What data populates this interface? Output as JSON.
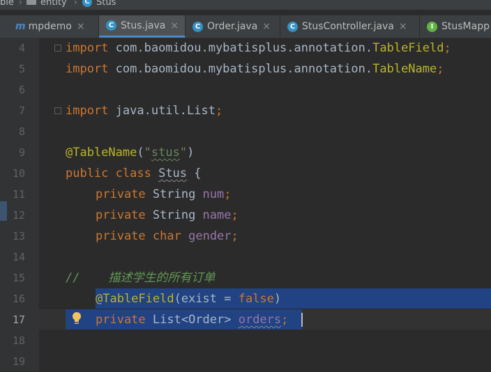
{
  "breadcrumb": {
    "items": [
      "ble",
      "entity",
      "Stus"
    ]
  },
  "tabs": [
    {
      "label": "mpdemo",
      "icon": "module-icon",
      "active": false
    },
    {
      "label": "Stus.java",
      "icon": "class-icon",
      "active": true
    },
    {
      "label": "Order.java",
      "icon": "class-icon",
      "active": false
    },
    {
      "label": "StusController.java",
      "icon": "class-icon",
      "active": false
    },
    {
      "label": "StusMapp",
      "icon": "interface-icon",
      "active": false
    }
  ],
  "close_glyph": "×",
  "icon_letters": {
    "class": "C",
    "interface": "I",
    "module": "m"
  },
  "line_numbers": [
    "4",
    "5",
    "6",
    "7",
    "8",
    "9",
    "10",
    "11",
    "12",
    "13",
    "14",
    "15",
    "16",
    "17",
    "18",
    "19"
  ],
  "code": {
    "l4": {
      "kw": "import",
      "pkg": " com.baomidou.mybatisplus.annotation.",
      "cls": "TableField",
      "end": ";"
    },
    "l5": {
      "kw": "import",
      "pkg": " com.baomidou.mybatisplus.annotation.",
      "cls": "TableName",
      "end": ";"
    },
    "l7": {
      "kw": "import",
      "pkg": " java.util.List",
      "end": ";"
    },
    "l9": {
      "ann": "@TableName",
      "open": "(",
      "q1": "\"",
      "str": "stus",
      "q2": "\"",
      "close": ")"
    },
    "l10": {
      "kw": "public class",
      "sp": " ",
      "name": "Stus",
      "brace": " {"
    },
    "l11": {
      "kw": "private",
      "type": " String ",
      "field": "num",
      "end": ";"
    },
    "l12": {
      "kw": "private",
      "type": " String ",
      "field": "name",
      "end": ";"
    },
    "l13": {
      "kw": "private",
      "type": " ",
      "type2": "char",
      "sp": " ",
      "field": "gender",
      "end": ";"
    },
    "l15": {
      "comment": "//    描述学生的所有订单"
    },
    "l16": {
      "ann": "@TableField",
      "open": "(exist = ",
      "kw": "false",
      "close": ")"
    },
    "l17": {
      "kw": "private",
      "type": " List<Order> ",
      "field": "orders",
      "end": ";"
    }
  },
  "colors": {
    "keyword": "#cc7832",
    "annotation": "#bbb529",
    "string": "#6a8759",
    "field": "#9876aa",
    "comment": "#629755",
    "selection": "#214283",
    "editor_bg": "#2b2b2b"
  }
}
